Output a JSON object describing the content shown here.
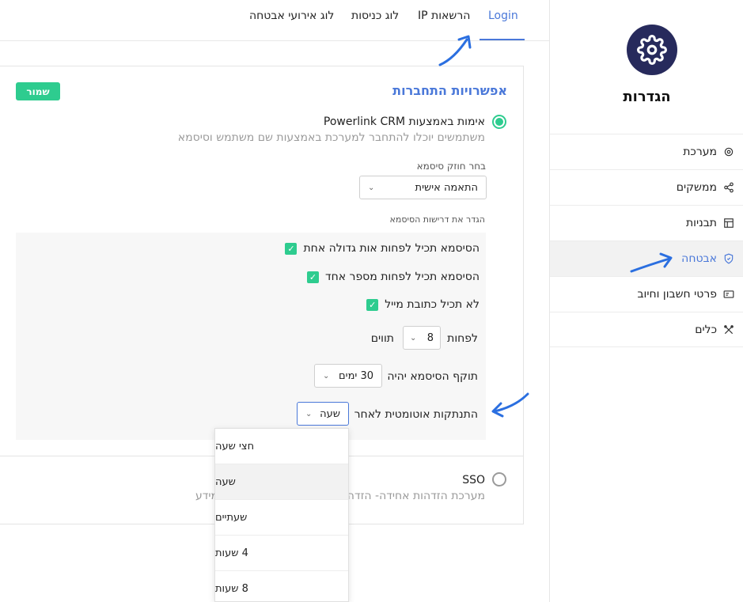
{
  "sidebar": {
    "title": "הגדרות",
    "items": [
      {
        "label": "מערכת",
        "icon": "gear-icon"
      },
      {
        "label": "ממשקים",
        "icon": "share-icon"
      },
      {
        "label": "תבניות",
        "icon": "layout-icon"
      },
      {
        "label": "אבטחה",
        "icon": "shield-icon",
        "active": true
      },
      {
        "label": "פרטי חשבון וחיוב",
        "icon": "card-icon"
      },
      {
        "label": "כלים",
        "icon": "tools-icon"
      }
    ]
  },
  "tabs": [
    {
      "label": "Login",
      "active": true
    },
    {
      "label": "הרשאות IP"
    },
    {
      "label": "לוג כניסות"
    },
    {
      "label": "לוג אירועי אבטחה"
    }
  ],
  "section": {
    "title": "אפשרויות התחברות",
    "save_label": "שמור"
  },
  "option_crm": {
    "title": "אימות באמצעות Powerlink CRM",
    "desc": "משתמשים יוכלו להתחבר למערכת באמצעות שם משתמש וסיסמא"
  },
  "password_strength": {
    "label": "בחר חוזק סיסמא",
    "value": "התאמה אישית"
  },
  "requirements": {
    "label": "הגדר את דרישות הסיסמא",
    "checks": [
      "הסיסמא תכיל לפחות אות גדולה אחת",
      "הסיסמא תכיל לפחות מספר אחד",
      "לא תכיל כתובת מייל"
    ],
    "min_prefix": "לפחות",
    "min_value": "8",
    "min_suffix": "תווים",
    "expiry_label": "תוקף הסיסמא יהיה",
    "expiry_value": "30 ימים",
    "logout_label": "התנתקות אוטומטית לאחר",
    "logout_value": "שעה"
  },
  "option_sso": {
    "title": "SSO",
    "desc_right": "מערכת הזדהות אחידה- הזדהו",
    "desc_left": "מידע"
  },
  "dropdown": {
    "options": [
      "חצי שעה",
      "שעה",
      "שעתיים",
      "4 שעות",
      "8 שעות"
    ],
    "highlighted": "שעה"
  },
  "colors": {
    "accent": "#4a78d9",
    "success": "#2ecc8f",
    "brand_dark": "#272a5c"
  }
}
